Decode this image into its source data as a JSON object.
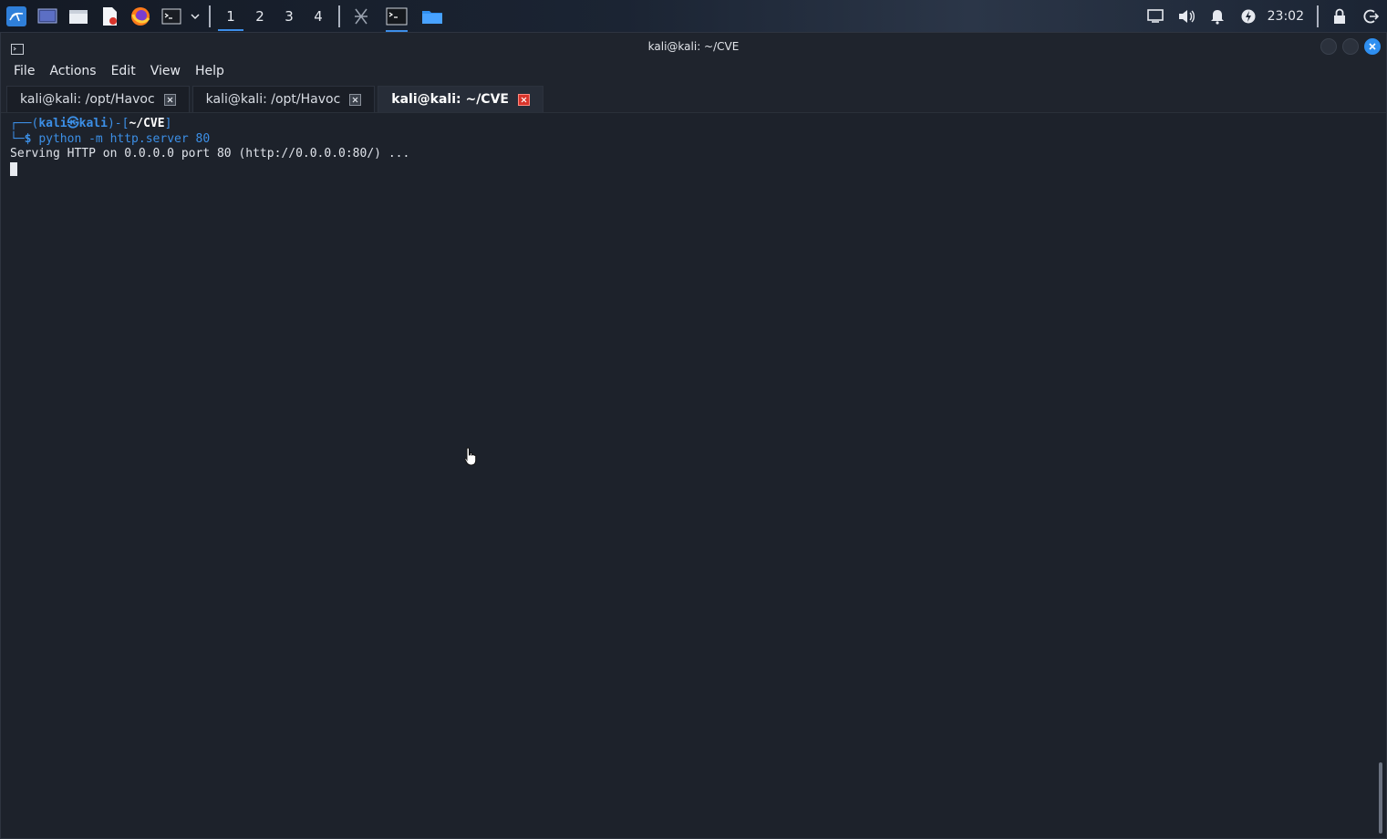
{
  "taskbar": {
    "workspaces": [
      {
        "label": "1",
        "active": true
      },
      {
        "label": "2",
        "active": false
      },
      {
        "label": "3",
        "active": false
      },
      {
        "label": "4",
        "active": false
      }
    ],
    "clock": "23:02",
    "icons": [
      "kali-menu-icon",
      "desktop-icon",
      "file-manager-icon",
      "text-editor-icon",
      "firefox-icon",
      "terminal-icon",
      "chevron-down-icon",
      "burp-icon",
      "terminal-task-icon",
      "folder-task-icon",
      "display-icon",
      "volume-icon",
      "bell-icon",
      "power-manager-icon",
      "lock-icon",
      "logout-icon"
    ]
  },
  "window": {
    "title": "kali@kali: ~/CVE"
  },
  "menubar": {
    "items": [
      "File",
      "Actions",
      "Edit",
      "View",
      "Help"
    ]
  },
  "tabs": [
    {
      "label": "kali@kali: /opt/Havoc",
      "active": false
    },
    {
      "label": "kali@kali: /opt/Havoc",
      "active": false
    },
    {
      "label": "kali@kali: ~/CVE",
      "active": true
    }
  ],
  "terminal": {
    "prompt_open": "┌──(",
    "user": "kali",
    "at": "㉿",
    "host": "kali",
    "prompt_mid": ")-[",
    "path": "~/CVE",
    "prompt_close": "]",
    "prompt_second": "└─",
    "dollar": "$ ",
    "command": "python -m http.server 80",
    "output": "Serving HTTP on 0.0.0.0 port 80 (http://0.0.0.0:80/) ..."
  },
  "colors": {
    "accent": "#3d8ee8",
    "background": "#1d222b",
    "tab_close_active": "#d9342b"
  }
}
